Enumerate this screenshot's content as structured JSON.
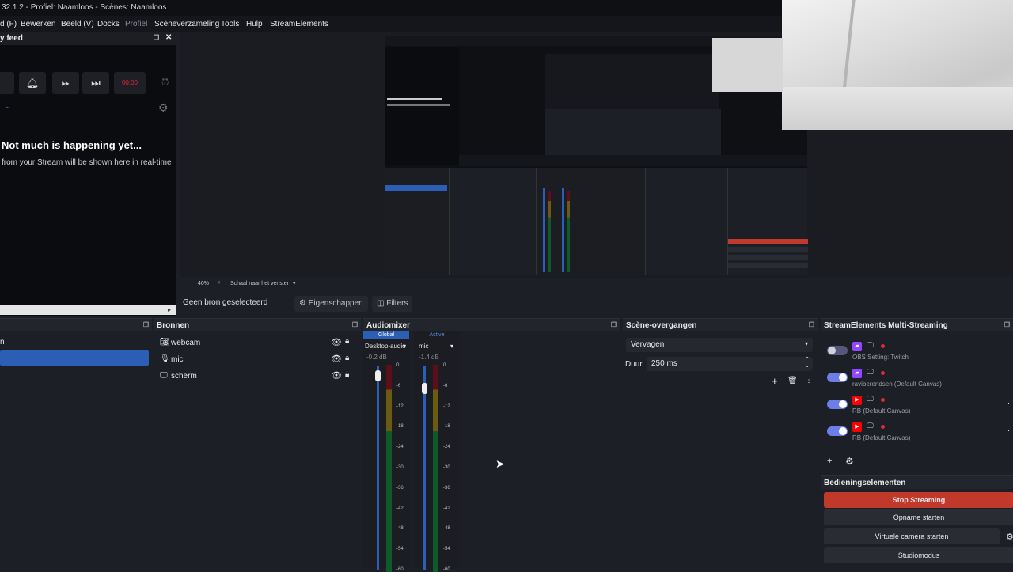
{
  "window": {
    "title": "32.1.2 - Profiel: Naamloos - Scènes: Naamloos"
  },
  "menu": {
    "items": [
      "d (F)",
      "Bewerken",
      "Beeld (V)",
      "Docks",
      "Profiel",
      "Scèneverzameling",
      "Tools",
      "Hulp",
      "StreamElements"
    ]
  },
  "feed": {
    "title": "y feed",
    "timer": "00:00",
    "empty_title": "Not much is happening yet...",
    "empty_sub": "from your Stream will be shown here in real-time"
  },
  "preview": {
    "zoom": "40%",
    "scale_label": "Schaal naar het venster",
    "minus": "−",
    "plus": "+"
  },
  "toolbar": {
    "no_source": "Geen bron geselecteerd",
    "properties": "Eigenschappen",
    "filters": "Filters"
  },
  "scenes": {
    "first_item": "n"
  },
  "sources": {
    "title": "Bronnen",
    "items": [
      {
        "label": "webcam",
        "icon": "camera-icon"
      },
      {
        "label": "mic",
        "icon": "microphone-icon"
      },
      {
        "label": "scherm",
        "icon": "monitor-icon"
      }
    ]
  },
  "mixer": {
    "title": "Audiomixer",
    "tabs": [
      "Global",
      "Active"
    ],
    "channels": [
      {
        "name": "Desktop-audio",
        "db": "-0.2 dB",
        "level": 0.98
      },
      {
        "name": "mic",
        "db": "-1.4 dB",
        "level": 0.92
      }
    ],
    "scale": [
      "0",
      "-6",
      "-12",
      "-18",
      "-24",
      "-30",
      "-36",
      "-42",
      "-48",
      "-54",
      "-60"
    ]
  },
  "transitions": {
    "title": "Scène-overgangen",
    "selected": "Vervagen",
    "duration_label": "Duur",
    "duration_value": "250 ms"
  },
  "multistream": {
    "title": "StreamElements Multi-Streaming",
    "rows": [
      {
        "label": "OBS Setting: Twitch",
        "platform": "twitch",
        "enabled": false
      },
      {
        "label": "raviberendsen (Default Canvas)",
        "platform": "twitch",
        "enabled": true
      },
      {
        "label": "RB (Default Canvas)",
        "platform": "youtube",
        "enabled": true
      },
      {
        "label": "RB (Default Canvas)",
        "platform": "youtube",
        "enabled": true
      }
    ]
  },
  "controls": {
    "title": "Bedieningselementen",
    "stop_streaming": "Stop Streaming",
    "start_recording": "Opname starten",
    "virtual_camera": "Virtuele camera starten",
    "studio_mode": "Studiomodus"
  },
  "colors": {
    "accent": "#2a5fb5",
    "stop": "#c0392b",
    "twitch": "#9146ff",
    "youtube": "#ff0000"
  }
}
